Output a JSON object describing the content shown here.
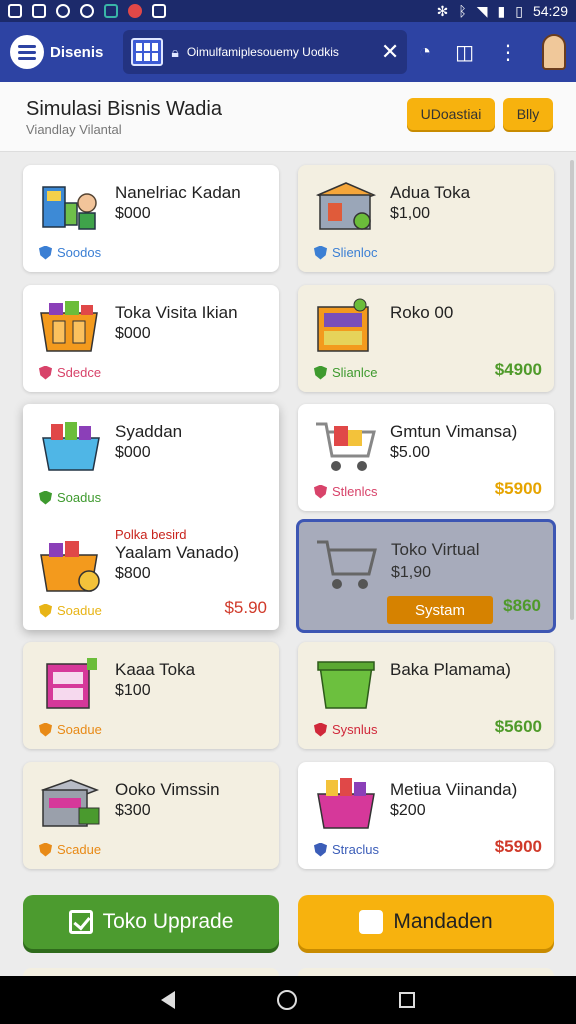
{
  "status_bar": {
    "time": "54:29"
  },
  "app_bar": {
    "app_name": "Disenis",
    "tab_text": "Oimulfamiplesouemy Uodkis"
  },
  "header": {
    "title": "Simulasi Bisnis Wadia",
    "subtitle": "Viandlay Vilantal",
    "button_1": "UDoastiai",
    "button_2": "Blly"
  },
  "cards": [
    {
      "name": "Nanelriac Kadan",
      "price": "$000",
      "status": "Soodos",
      "status_color": "#3b7fd4",
      "amount": "",
      "icon": "building-blocks-icon"
    },
    {
      "name": "Adua Toka",
      "price": "$1,00",
      "status": "Slienloc",
      "status_color": "#3b7fd4",
      "amount": "",
      "icon": "shop-icon"
    },
    {
      "name": "Toka Visita Ikian",
      "price": "$000",
      "status": "Sdedce",
      "status_color": "#d8436a",
      "amount": "",
      "icon": "orange-box-icon"
    },
    {
      "name": "Roko 00",
      "price": "",
      "status": "Slianlce",
      "status_color": "#3e9a2e",
      "amount": "$4900",
      "icon": "shelf-icon"
    },
    {
      "name": "Gmtun Vimansa)",
      "price": "$5.00",
      "status": "Stlenlcs",
      "status_color": "#d8436a",
      "amount": "$5900",
      "icon": "shopping-cart-icon"
    },
    {
      "name": "Kaaa Toka",
      "price": "$100",
      "status": "Soadue",
      "status_color": "#e88a16",
      "amount": "",
      "icon": "pink-cabinet-icon"
    },
    {
      "name": "Baka Plamama)",
      "price": "",
      "status": "Sysnlus",
      "status_color": "#d0283a",
      "amount": "$5600",
      "icon": "green-bin-icon"
    },
    {
      "name": "Ooko Vimssin",
      "price": "$300",
      "status": "Scadue",
      "status_color": "#e88a16",
      "amount": "",
      "icon": "gray-crate-icon"
    },
    {
      "name": "Metiua Viinanda)",
      "price": "$200",
      "status": "Straclus",
      "status_color": "#3b5db8",
      "amount": "$5900",
      "icon": "pink-basket-icon"
    }
  ],
  "featured": {
    "item_1": {
      "name": "Syaddan",
      "price": "$000",
      "status": "Soadus",
      "status_color": "#3e9a2e"
    },
    "item_2": {
      "promo": "Polka besird",
      "name": "Yaalam Vanado)",
      "price": "$800",
      "status": "Soadue",
      "status_color": "#e8b416",
      "amount": "$5.90"
    }
  },
  "selected_card": {
    "name": "Toko Virtual",
    "price": "$1,90",
    "action": "Systam",
    "amount": "$860"
  },
  "bottom_buttons": {
    "upgrade": "Toko Upprade",
    "manage": "Mandaden"
  }
}
